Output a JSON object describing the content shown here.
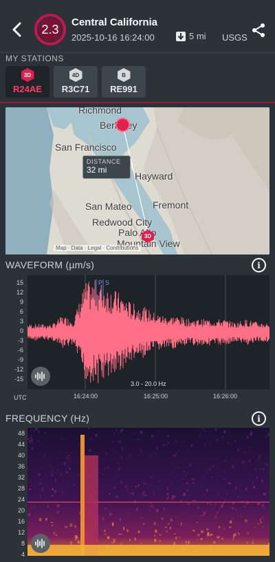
{
  "header": {
    "magnitude": "2.3",
    "region": "Central California",
    "datetime": "2025-10-16 16:24:00",
    "distance": "5 mi",
    "source": "USGS",
    "colors": {
      "magnitude_ring": "#c3164e",
      "accent": "#e0214f"
    },
    "icons": [
      "back-chevron-icon",
      "down-arrow-icon",
      "share-icon"
    ]
  },
  "stations": {
    "section_label": "MY STATIONS",
    "items": [
      {
        "badge": "3D",
        "code": "R24AE",
        "active": true
      },
      {
        "badge": "4D",
        "code": "R3C71",
        "active": false
      },
      {
        "badge": "B",
        "code": "RE991",
        "active": false
      }
    ]
  },
  "map": {
    "labels": [
      "Richmond",
      "Berkeley",
      "San Francisco",
      "Hayward",
      "San Mateo",
      "Fremont",
      "Redwood City",
      "Palo Alto",
      "Mountain View"
    ],
    "distance_label": "DISTANCE",
    "distance_value": "32 mi",
    "station_badge": "3D",
    "credit": "Map · Data · Legal · Contributions"
  },
  "waveform": {
    "title": "WAVEFORM (µm/s)",
    "y_ticks": [
      "15",
      "12",
      "9",
      "6",
      "3",
      "0",
      "-3",
      "-6",
      "-9",
      "-12",
      "-15"
    ],
    "x_ticks": [
      "16:24:00",
      "16:25:00",
      "16:26:00"
    ],
    "utc_label": "UTC",
    "phase_labels": [
      "P",
      "S"
    ],
    "filter": "3.0 - 20.0 Hz",
    "color": "#ff6f86"
  },
  "frequency": {
    "title": "FREQUENCY (Hz)",
    "y_ticks": [
      "48",
      "44",
      "40",
      "36",
      "32",
      "28",
      "24",
      "20",
      "16",
      "12",
      "8",
      "4"
    ]
  },
  "chart_data": [
    {
      "type": "line",
      "title": "WAVEFORM (µm/s)",
      "ylabel": "µm/s",
      "ylim": [
        -16,
        16
      ],
      "x_ticks": [
        "16:24:00",
        "16:25:00",
        "16:26:00"
      ],
      "grid": true,
      "series": [
        {
          "values": [
            0,
            2,
            -2,
            5,
            -4,
            15,
            -16,
            14,
            -12,
            9,
            -8,
            6,
            -5,
            5,
            -4,
            4,
            -4,
            4,
            -3,
            4,
            -3,
            3
          ]
        }
      ]
    },
    {
      "type": "heatmap",
      "title": "FREQUENCY (Hz)",
      "ylim": [
        0,
        50
      ],
      "y_ticks": [
        48,
        44,
        40,
        36,
        32,
        28,
        24,
        20,
        16,
        12,
        8,
        4
      ]
    }
  ]
}
